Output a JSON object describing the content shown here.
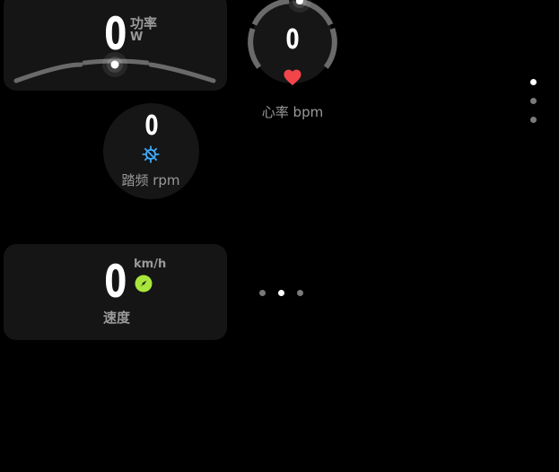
{
  "power": {
    "value": "0",
    "label": "功率",
    "unit": "W",
    "level": 0.5
  },
  "heart_rate": {
    "value": "0",
    "label": "心率 bpm",
    "heart_color": "#f2454a"
  },
  "cadence": {
    "value": "0",
    "label": "踏频 rpm",
    "icon_color": "#3fa8f5"
  },
  "speed": {
    "value": "0",
    "unit": "km/h",
    "label": "速度",
    "icon_color": "#a8e63c"
  },
  "pager_horizontal": {
    "count": 3,
    "active_index": 1
  },
  "pager_vertical": {
    "count": 3,
    "active_index": 0
  }
}
